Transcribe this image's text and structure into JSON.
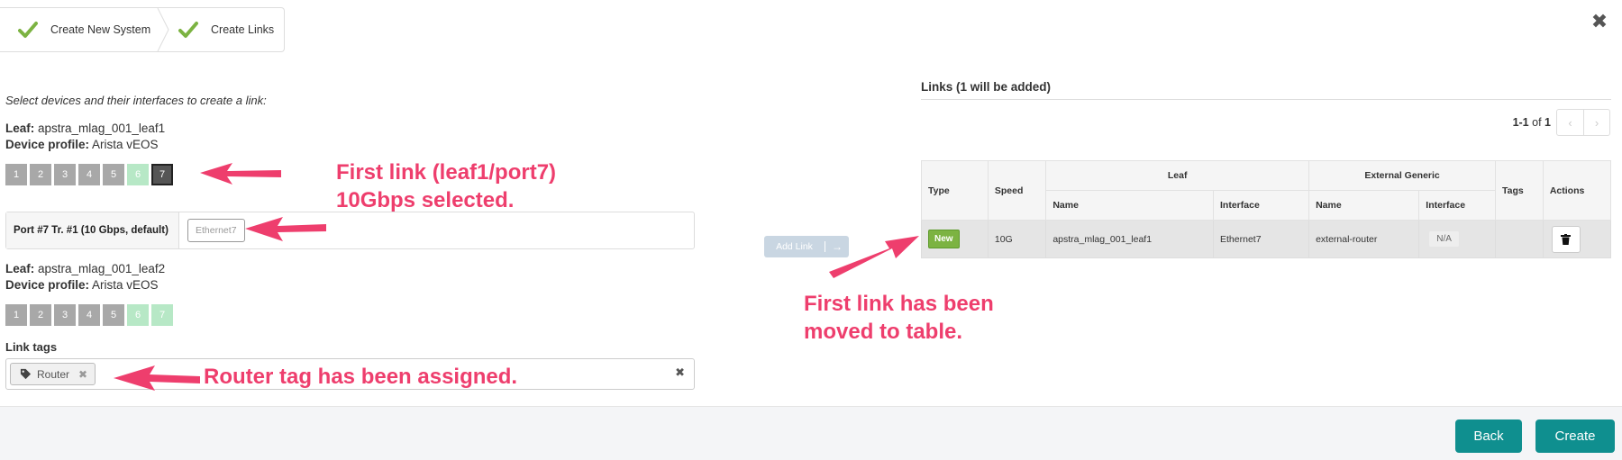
{
  "wizard": {
    "steps": [
      {
        "label": "Create New System"
      },
      {
        "label": "Create Links"
      }
    ]
  },
  "instructions": "Select devices and their interfaces to create a link:",
  "leaf1": {
    "role_label": "Leaf:",
    "name": "apstra_mlag_001_leaf1",
    "profile_label": "Device profile:",
    "profile": "Arista vEOS",
    "ports": [
      {
        "num": "1",
        "state": "used"
      },
      {
        "num": "2",
        "state": "used"
      },
      {
        "num": "3",
        "state": "used"
      },
      {
        "num": "4",
        "state": "used"
      },
      {
        "num": "5",
        "state": "used"
      },
      {
        "num": "6",
        "state": "available"
      },
      {
        "num": "7",
        "state": "selected"
      }
    ]
  },
  "port_row": {
    "label": "Port #7 Tr. #1 (10 Gbps, default)",
    "interface": "Ethernet7"
  },
  "leaf2": {
    "role_label": "Leaf:",
    "name": "apstra_mlag_001_leaf2",
    "profile_label": "Device profile:",
    "profile": "Arista vEOS",
    "ports": [
      {
        "num": "1",
        "state": "used"
      },
      {
        "num": "2",
        "state": "used"
      },
      {
        "num": "3",
        "state": "used"
      },
      {
        "num": "4",
        "state": "used"
      },
      {
        "num": "5",
        "state": "used"
      },
      {
        "num": "6",
        "state": "available"
      },
      {
        "num": "7",
        "state": "available"
      }
    ]
  },
  "tags": {
    "label": "Link tags",
    "chips": [
      {
        "label": "Router"
      }
    ]
  },
  "add_link": {
    "label": "Add Link",
    "arrow": "→"
  },
  "links": {
    "title": "Links (1 will be added)",
    "pager_range": "1-1",
    "pager_of": "of",
    "pager_total": "1",
    "headers": {
      "type": "Type",
      "speed": "Speed",
      "leaf": "Leaf",
      "external": "External Generic",
      "tags": "Tags",
      "actions": "Actions",
      "name": "Name",
      "interface": "Interface"
    },
    "rows": [
      {
        "type": "New",
        "speed": "10G",
        "leaf_name": "apstra_mlag_001_leaf1",
        "leaf_interface": "Ethernet7",
        "ext_name": "external-router",
        "ext_interface": "N/A",
        "tags": ""
      }
    ]
  },
  "footer": {
    "back": "Back",
    "create": "Create"
  },
  "annotations": {
    "first_link_line1": "First link (leaf1/port7)",
    "first_link_line2": "10Gbps selected.",
    "router_tag": "Router tag has been assigned.",
    "moved_line1": "First link has been",
    "moved_line2": "moved to table."
  },
  "colors": {
    "accent": "#0f8f8f",
    "annotation": "#ee3e6d",
    "check": "#7cb342",
    "new_badge": "#7cb342",
    "port_used": "#a8a8a8",
    "port_available": "#b7e8c6",
    "port_selected": "#555555"
  }
}
